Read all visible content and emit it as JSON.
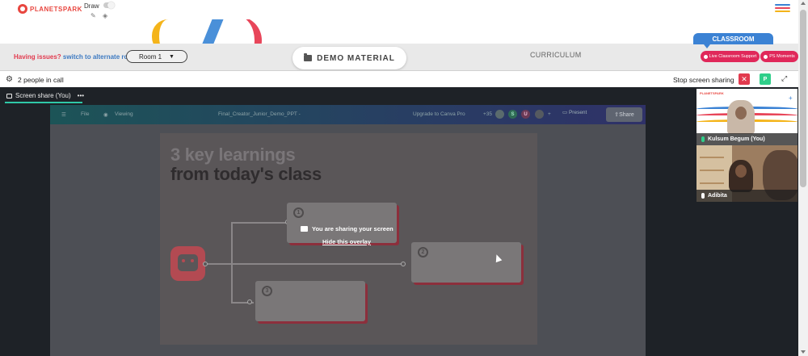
{
  "header": {
    "logo_text": "PLANETSPARK",
    "draw_label": "Draw",
    "menu_icon": "hamburger-icon",
    "menu_colors": [
      "#3b82d4",
      "#e8465a",
      "#f4b41a"
    ]
  },
  "room_bar": {
    "issues_text": "Having issues?",
    "alt_room_link": "switch to alternate room",
    "room_select_value": "Room 1",
    "demo_material_label": "DEMO MATERIAL",
    "curriculum_label": "CURRICULUM",
    "classroom_tab_label": "CLASSROOM",
    "live_support_label": "Live Classroom Support",
    "ps_moments_label": "PS Moments"
  },
  "call_bar": {
    "people_count_text": "2 people in call",
    "stop_share_label": "Stop screen sharing",
    "close_glyph": "✕",
    "avatar_letter": "P"
  },
  "screen_share": {
    "tab_label": "Screen share (You)",
    "tab_more": "•••",
    "overlay_message": "You are sharing your screen",
    "hide_overlay_link": "Hide this overlay"
  },
  "canva": {
    "menu_file": "File",
    "menu_viewing": "Viewing",
    "doc_title": "Final_Creator_Junior_Demo_PPT -",
    "upgrade_label": "Upgrade to Canva Pro",
    "collab_count": "+35",
    "present_label": "Present",
    "share_label": "Share",
    "slide_title_line1": "3 key learnings",
    "slide_title_line2": "from today's class",
    "card_numbers": [
      "1",
      "2",
      "3"
    ],
    "avatar_letters": [
      "S",
      "U"
    ]
  },
  "participants": [
    {
      "name": "Kulsum Begum (You)"
    },
    {
      "name": "Adibita"
    }
  ],
  "colors": {
    "accent_blue": "#3b82d4",
    "alert_red": "#e23a4e",
    "pill_pink": "#e0285a",
    "teal": "#2fc9a8",
    "green": "#2fcf8a"
  }
}
